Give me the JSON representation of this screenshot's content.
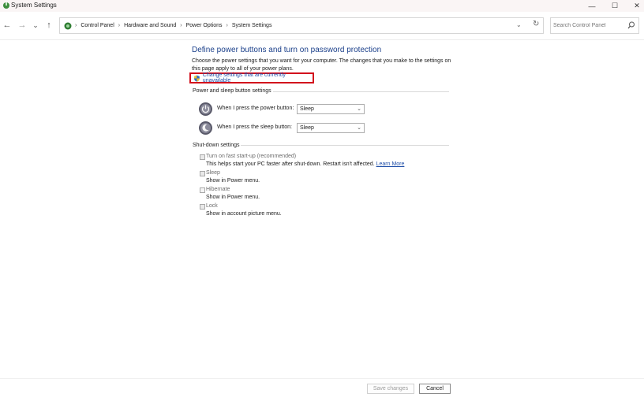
{
  "window": {
    "title": "System Settings",
    "controls": {
      "minimize": "—",
      "maximize": "☐",
      "close": "✕"
    }
  },
  "nav": {
    "back": "←",
    "forward": "→",
    "recent": "⌄",
    "up": "↑"
  },
  "breadcrumb": [
    "Control Panel",
    "Hardware and Sound",
    "Power Options",
    "System Settings"
  ],
  "search": {
    "placeholder": "Search Control Panel"
  },
  "page": {
    "heading": "Define power buttons and turn on password protection",
    "description": "Choose the power settings that you want for your computer. The changes that you make to the settings on this page apply to all of your power plans.",
    "change_link": "Change settings that are currently unavailable"
  },
  "power_section": {
    "title": "Power and sleep button settings",
    "rows": [
      {
        "label": "When I press the power button:",
        "value": "Sleep"
      },
      {
        "label": "When I press the sleep button:",
        "value": "Sleep"
      }
    ]
  },
  "shutdown_section": {
    "title": "Shut-down settings",
    "options": [
      {
        "name": "Turn on fast start-up (recommended)",
        "sub": "This helps start your PC faster after shut-down. Restart isn't affected.",
        "link": "Learn More",
        "checked": true
      },
      {
        "name": "Sleep",
        "sub": "Show in Power menu.",
        "checked": true
      },
      {
        "name": "Hibernate",
        "sub": "Show in Power menu.",
        "checked": false
      },
      {
        "name": "Lock",
        "sub": "Show in account picture menu.",
        "checked": true
      }
    ]
  },
  "footer": {
    "save": "Save changes",
    "cancel": "Cancel"
  },
  "colors": {
    "heading": "#1a3f8a",
    "link": "#1f4ea8",
    "highlight": "#d20f1c"
  }
}
